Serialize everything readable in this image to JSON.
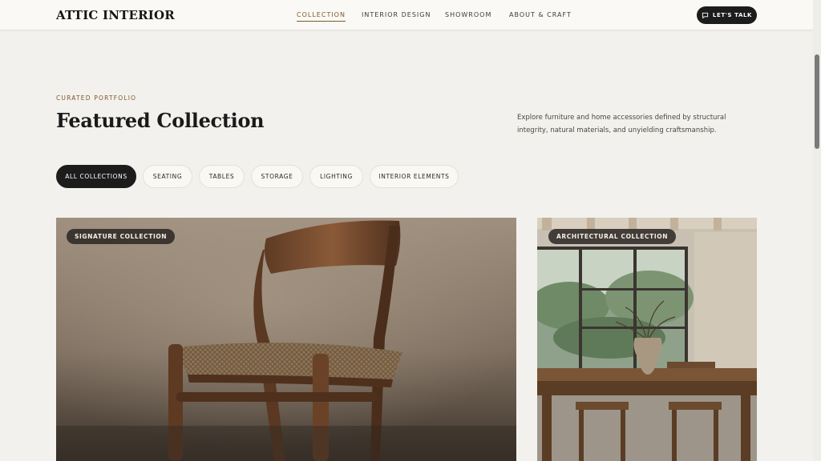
{
  "header": {
    "brand": "ATTIC INTERIOR",
    "nav": [
      {
        "label": "COLLECTION",
        "active": true
      },
      {
        "label": "INTERIOR DESIGN",
        "active": false
      },
      {
        "label": "SHOWROOM",
        "active": false
      },
      {
        "label": "ABOUT & CRAFT",
        "active": false
      }
    ],
    "cta": {
      "label": "LET'S TALK",
      "icon": "chat-bubble-icon"
    }
  },
  "hero": {
    "eyebrow": "CURATED PORTFOLIO",
    "title": "Featured Collection",
    "intro": "Explore furniture and home accessories defined by structural integrity, natural materials, and unyielding craftsmanship."
  },
  "filters": [
    {
      "label": "ALL COLLECTIONS",
      "active": true
    },
    {
      "label": "SEATING",
      "active": false
    },
    {
      "label": "TABLES",
      "active": false
    },
    {
      "label": "STORAGE",
      "active": false
    },
    {
      "label": "LIGHTING",
      "active": false
    },
    {
      "label": "INTERIOR ELEMENTS",
      "active": false
    }
  ],
  "cards": [
    {
      "badge": "SIGNATURE COLLECTION",
      "image": "wooden-chair-photo"
    },
    {
      "badge": "ARCHITECTURAL COLLECTION",
      "image": "dining-room-photo"
    }
  ],
  "colors": {
    "background": "#f3f1ed",
    "accent": "#7a5a2c",
    "dark": "#1c1c1c"
  }
}
